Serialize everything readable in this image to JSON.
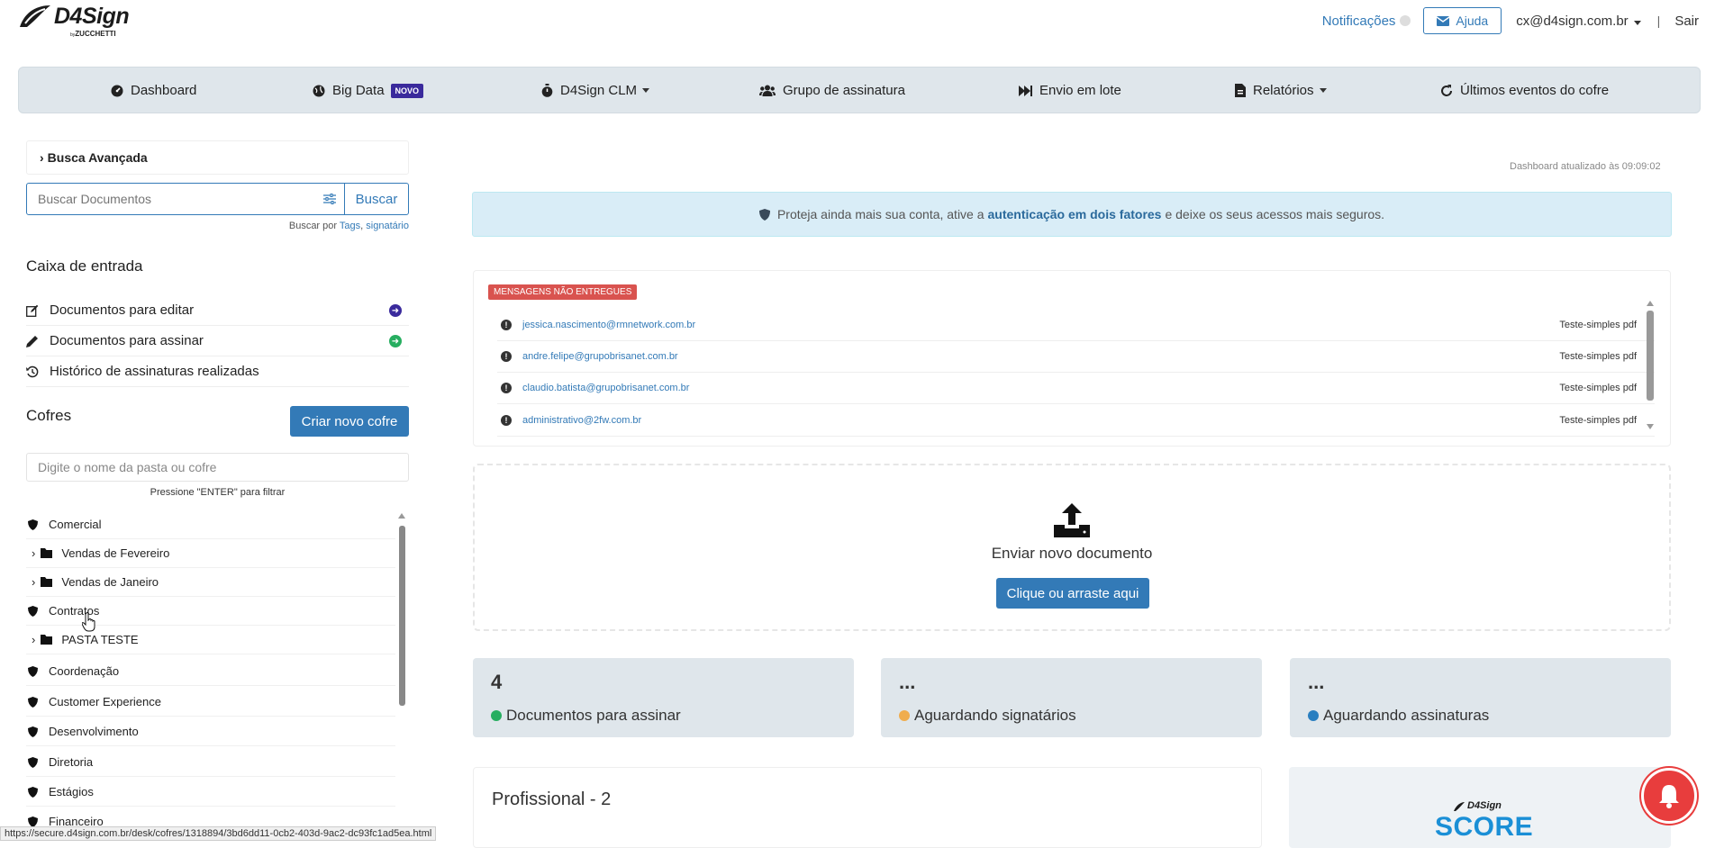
{
  "header": {
    "logo_text": "D4Sign",
    "logo_by": "by",
    "logo_sub": "ZUCCHETTI",
    "notifications_label": "Notificações",
    "help_label": "Ajuda",
    "user_email": "cx@d4sign.com.br",
    "separator": "|",
    "logout_label": "Sair"
  },
  "nav": {
    "items": [
      {
        "label": "Dashboard",
        "icon": "dashboard-icon"
      },
      {
        "label": "Big Data",
        "icon": "globe-icon",
        "badge": "NOVO"
      },
      {
        "label": "D4Sign CLM",
        "icon": "stopwatch-icon",
        "dropdown": true
      },
      {
        "label": "Grupo de assinatura",
        "icon": "users-icon"
      },
      {
        "label": "Envio em lote",
        "icon": "fast-forward-icon"
      },
      {
        "label": "Relatórios",
        "icon": "report-icon",
        "dropdown": true
      },
      {
        "label": "Últimos eventos do cofre",
        "icon": "refresh-icon"
      }
    ]
  },
  "sidebar": {
    "advanced_search_label": "Busca Avançada",
    "search_placeholder": "Buscar Documentos",
    "search_button": "Buscar",
    "search_hint_prefix": "Buscar por",
    "search_hint_tags": "Tags",
    "search_hint_sep": ",",
    "search_hint_signer": "signatário",
    "inbox_title": "Caixa de entrada",
    "inbox_items": [
      {
        "label": "Documentos para editar",
        "icon": "edit-icon",
        "arrow_color": "#3a2a9c"
      },
      {
        "label": "Documentos para assinar",
        "icon": "pencil-icon",
        "arrow_color": "#27ae60"
      },
      {
        "label": "Histórico de assinaturas realizadas",
        "icon": "history-icon"
      }
    ],
    "cofres_title": "Cofres",
    "new_cofre_button": "Criar novo cofre",
    "cofre_filter_placeholder": "Digite o nome da pasta ou cofre",
    "cofre_filter_hint": "Pressione \"ENTER\" para filtrar",
    "tree": [
      {
        "label": "Comercial",
        "type": "cofre"
      },
      {
        "label": "Vendas de Fevereiro",
        "type": "folder"
      },
      {
        "label": "Vendas de Janeiro",
        "type": "folder"
      },
      {
        "label": "Contratos",
        "type": "cofre"
      },
      {
        "label": "PASTA TESTE",
        "type": "folder"
      },
      {
        "label": "Coordenação",
        "type": "cofre"
      },
      {
        "label": "Customer Experience",
        "type": "cofre"
      },
      {
        "label": "Desenvolvimento",
        "type": "cofre"
      },
      {
        "label": "Diretoria",
        "type": "cofre"
      },
      {
        "label": "Estágios",
        "type": "cofre"
      },
      {
        "label": "Financeiro",
        "type": "cofre"
      }
    ]
  },
  "main": {
    "updated_text": "Dashboard atualizado às 09:09:02",
    "alert_prefix": "Proteja ainda mais sua conta, ative a",
    "alert_link": "autenticação em dois fatores",
    "alert_suffix": "e deixe os seus acessos mais seguros.",
    "undelivered_badge": "MENSAGENS NÃO ENTREGUES",
    "undelivered": [
      {
        "email": "jessica.nascimento@rmnetwork.com.br",
        "file": "Teste-simples pdf"
      },
      {
        "email": "andre.felipe@grupobrisanet.com.br",
        "file": "Teste-simples pdf"
      },
      {
        "email": "claudio.batista@grupobrisanet.com.br",
        "file": "Teste-simples pdf"
      },
      {
        "email": "administrativo@2fw.com.br",
        "file": "Teste-simples pdf"
      }
    ],
    "upload_title": "Enviar novo documento",
    "upload_button": "Clique ou arraste aqui",
    "cards": [
      {
        "value": "4",
        "label": "Documentos para assinar",
        "color": "#27ae60"
      },
      {
        "value": "...",
        "label": "Aguardando signatários",
        "color": "#f0ad4e"
      },
      {
        "value": "...",
        "label": "Aguardando assinaturas",
        "color": "#2a7fc0"
      }
    ],
    "plan_title": "Profissional - 2",
    "score_brand": "D4Sign",
    "score_text": "SCORE"
  },
  "statusbar": {
    "url": "https://secure.d4sign.com.br/desk/cofres/1318894/3bd6dd11-0cb2-403d-9ac2-dc93fc1ad5ea.html"
  }
}
